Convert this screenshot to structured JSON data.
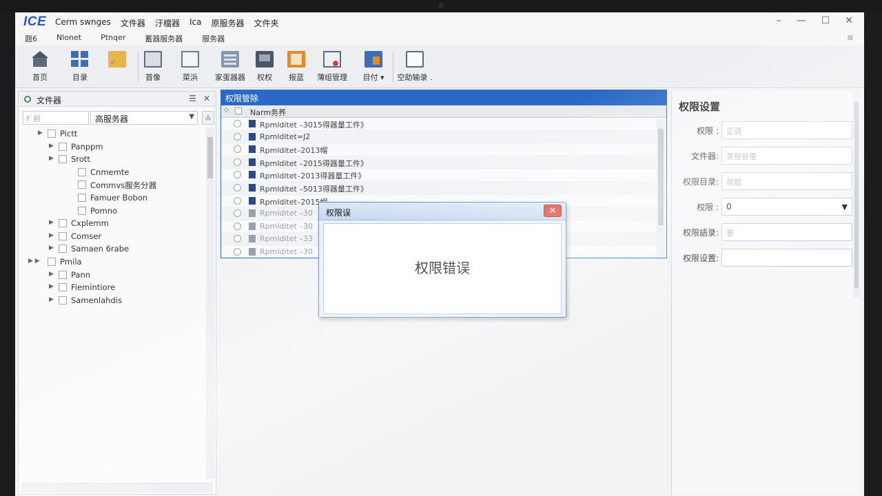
{
  "app": {
    "logo": "ICE"
  },
  "menu": [
    "Cerm swnges",
    "文件器",
    "汙檔器",
    "Ica",
    "原服务器",
    "文件夹"
  ],
  "window_controls": [
    "–",
    "—",
    "☐",
    "✕"
  ],
  "submenu": [
    "题6",
    "Nlonet",
    "Ptnqer",
    "蓄器服务器",
    "服务器"
  ],
  "toolbar": [
    {
      "label": "首页",
      "icon": "home-icon"
    },
    {
      "label": "目录",
      "icon": "directory-icon"
    },
    {
      "label": "",
      "icon": "folder-icon"
    },
    {
      "label": "首像",
      "icon": "monitor-icon"
    },
    {
      "label": "菜浜",
      "icon": "document-icon"
    },
    {
      "label": "家蛋器器",
      "icon": "server-icon"
    },
    {
      "label": "权权",
      "icon": "permission-icon"
    },
    {
      "label": "报蓝",
      "icon": "report-icon"
    },
    {
      "label": "薄组管理",
      "icon": "group-icon"
    },
    {
      "label": "目付 ▾",
      "icon": "calendar-icon"
    },
    {
      "label": "空助输录 .",
      "icon": "screen-icon"
    }
  ],
  "left_panel": {
    "title": "文件器",
    "filter_placeholder": "F 剖",
    "combo_value": "高服务器",
    "tree": [
      {
        "label": "Pictt",
        "level": 0,
        "expand": "▶"
      },
      {
        "label": "Panppm",
        "level": 1,
        "expand": "▶"
      },
      {
        "label": "Srott",
        "level": 1,
        "expand": "▶"
      },
      {
        "label": "Cnmemte",
        "level": 2,
        "expand": ""
      },
      {
        "label": "Commvs服务分器",
        "level": 2,
        "expand": ""
      },
      {
        "label": "Famuer Bobon",
        "level": 2,
        "expand": ""
      },
      {
        "label": "Pomno",
        "level": 2,
        "expand": ""
      },
      {
        "label": "Cxplemm",
        "level": 1,
        "expand": "▶"
      },
      {
        "label": "Comser",
        "level": 1,
        "expand": "▶"
      },
      {
        "label": "Samaen 6rabe",
        "level": 1,
        "expand": "▶"
      },
      {
        "label": "Pmila",
        "level": 0,
        "expand": "▶ ▶"
      },
      {
        "label": "Pann",
        "level": 1,
        "expand": "▶"
      },
      {
        "label": "Fiemintiore",
        "level": 1,
        "expand": "▶"
      },
      {
        "label": "Samenlahdis",
        "level": 1,
        "expand": "▶"
      }
    ]
  },
  "center": {
    "title": "权限管除",
    "column": "Narm务荞",
    "rows": [
      {
        "label": "Rpmlditet –3015得器量工件》",
        "dim": false
      },
      {
        "label": "Rpmlditet=J2",
        "dim": false
      },
      {
        "label": "Rpmlditet–2013帽",
        "dim": false
      },
      {
        "label": "Rpmlditet –2015得器量工件》",
        "dim": false
      },
      {
        "label": "Rpmlditet–2013得器量工件》",
        "dim": false
      },
      {
        "label": "Rpmlditet –5013得器量工件》",
        "dim": false
      },
      {
        "label": "Rpmlditet–2015帽",
        "dim": false
      },
      {
        "label": "Rpmlditet –30",
        "dim": true
      },
      {
        "label": "Rpmlditet –30",
        "dim": true
      },
      {
        "label": "Rpmlditet –33",
        "dim": true
      },
      {
        "label": "Rpmlditet –30",
        "dim": true
      }
    ]
  },
  "right_panel": {
    "title": "权限设置",
    "fields": [
      {
        "label": "权限 :",
        "value": "正调",
        "select": false
      },
      {
        "label": "文件器:",
        "value": "茶服管覆",
        "select": false
      },
      {
        "label": "权限目录:",
        "value": "荷婚",
        "select": false
      },
      {
        "label": "权限   :",
        "value": "0",
        "select": true
      },
      {
        "label": "权限語录:",
        "value": "答",
        "select": false
      },
      {
        "label": "权限设置:",
        "value": "",
        "select": false
      }
    ]
  },
  "dialog": {
    "title": "权限误",
    "message": "权限错误",
    "close": "✕"
  }
}
